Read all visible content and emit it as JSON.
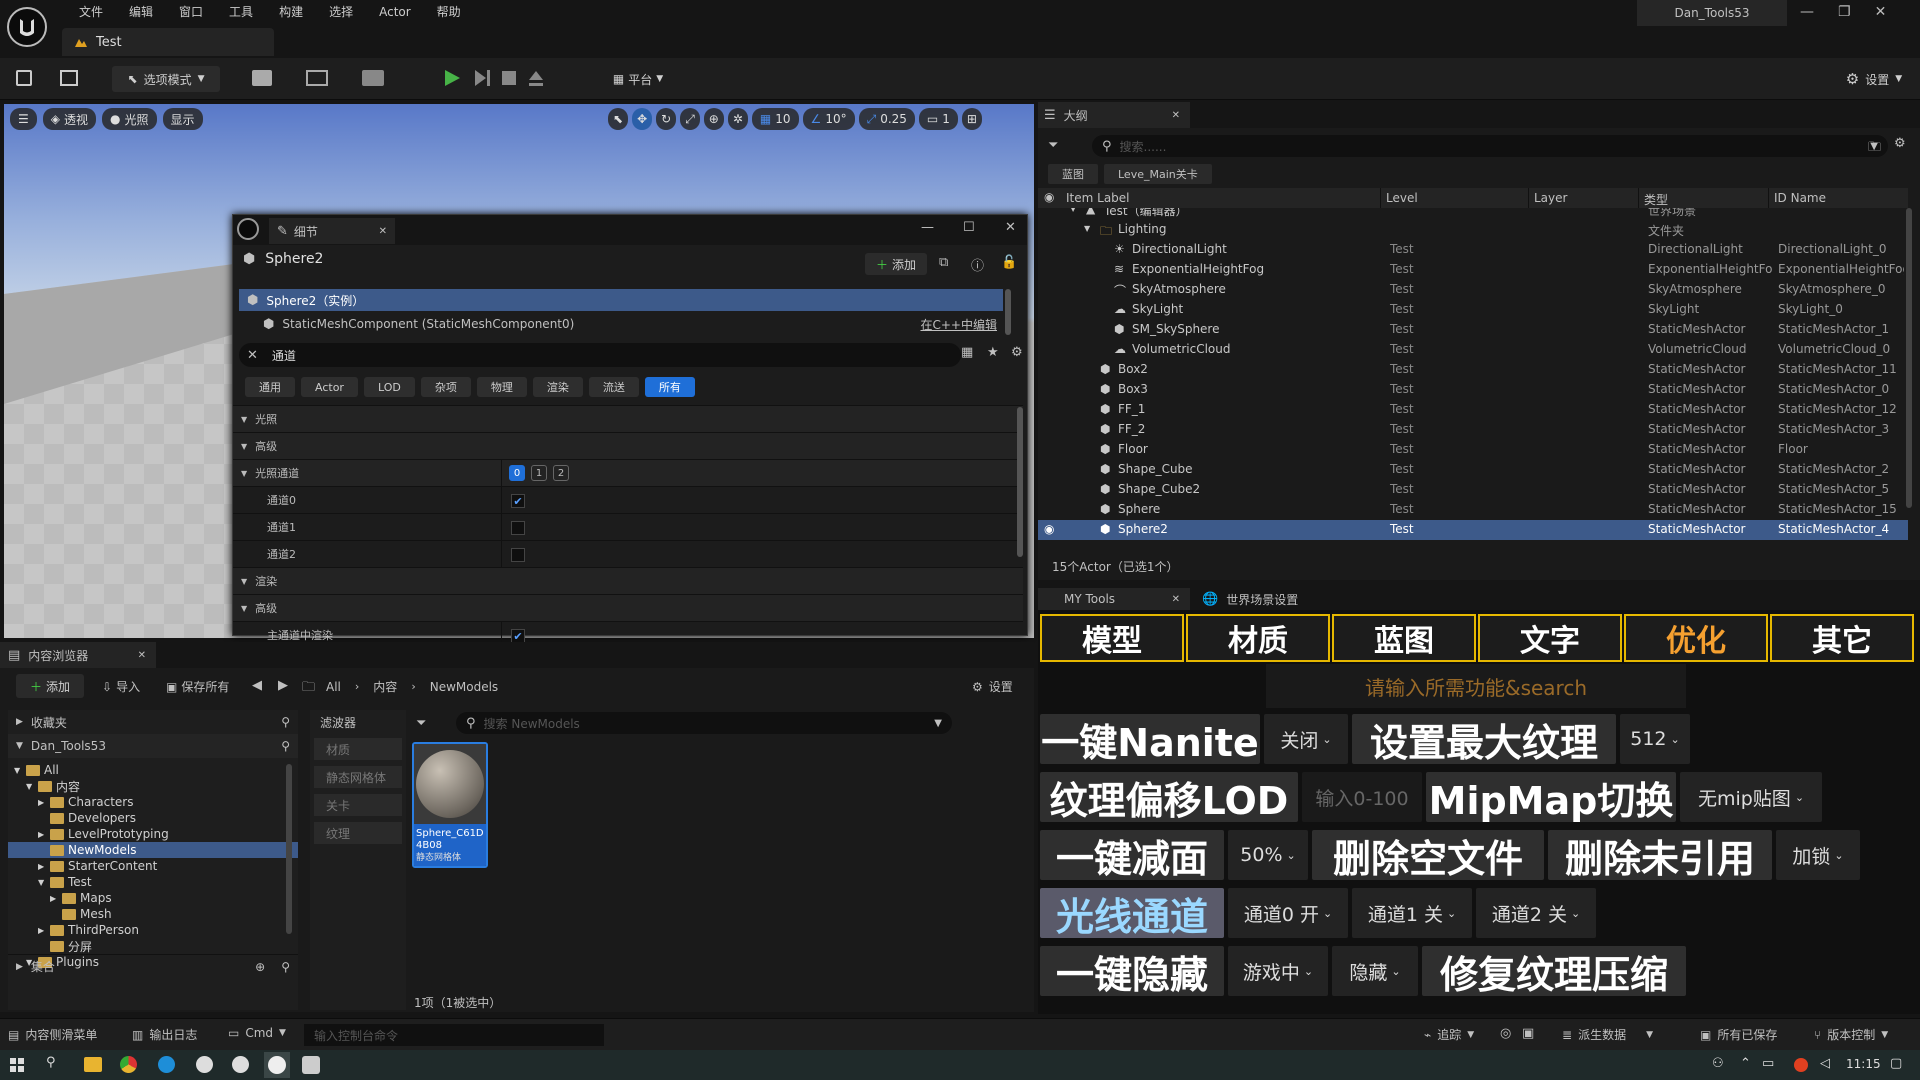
{
  "menu": [
    "文件",
    "编辑",
    "窗口",
    "工具",
    "构建",
    "选择",
    "Actor",
    "帮助"
  ],
  "project_name": "Dan_Tools53",
  "level_tab": "Test",
  "toolbar": {
    "mode": "选项模式",
    "platform": "平台",
    "settings": "设置"
  },
  "viewport": {
    "view": "透视",
    "lighting": "光照",
    "show": "显示",
    "grid": "10",
    "angle": "10°",
    "scale": "0.25",
    "camera": "1"
  },
  "details": {
    "title": "细节",
    "object": "Sphere2",
    "add": "添加",
    "instance": "Sphere2（实例）",
    "component": "StaticMeshComponent (StaticMeshComponent0)",
    "edit_cpp": "在C++中编辑",
    "search_value": "通道",
    "tabs": [
      "通用",
      "Actor",
      "LOD",
      "杂项",
      "物理",
      "渲染",
      "流送",
      "所有"
    ],
    "sections": [
      {
        "label": "光照",
        "level": 0,
        "type": "section"
      },
      {
        "label": "高级",
        "level": 0,
        "type": "section"
      },
      {
        "label": "光照通道",
        "level": 0,
        "type": "channels",
        "channels": [
          "0",
          "1",
          "2"
        ]
      },
      {
        "label": "通道0",
        "level": 1,
        "type": "checkbox",
        "checked": true
      },
      {
        "label": "通道1",
        "level": 1,
        "type": "checkbox",
        "checked": false
      },
      {
        "label": "通道2",
        "level": 1,
        "type": "checkbox",
        "checked": false
      },
      {
        "label": "渲染",
        "level": 0,
        "type": "section"
      },
      {
        "label": "高级",
        "level": 0,
        "type": "section"
      },
      {
        "label": "主通道中渲染",
        "level": 1,
        "type": "checkbox",
        "checked": true
      }
    ]
  },
  "outliner": {
    "title": "大纲",
    "search_placeholder": "搜索......",
    "filters": [
      "蓝图",
      "Leve_Main关卡"
    ],
    "columns": [
      "Item Label",
      "Level",
      "Layer",
      "类型",
      "ID Name"
    ],
    "rows": [
      {
        "label": "Test（编辑器）",
        "level": "",
        "type": "世界场景",
        "id": "",
        "indent": 0,
        "icon": "level"
      },
      {
        "label": "Lighting",
        "level": "",
        "type": "文件夹",
        "id": "",
        "indent": 1,
        "icon": "folder"
      },
      {
        "label": "DirectionalLight",
        "level": "Test",
        "type": "DirectionalLight",
        "id": "DirectionalLight_0",
        "indent": 2,
        "icon": "light"
      },
      {
        "label": "ExponentialHeightFog",
        "level": "Test",
        "type": "ExponentialHeightFog",
        "id": "ExponentialHeightFog",
        "indent": 2,
        "icon": "fog"
      },
      {
        "label": "SkyAtmosphere",
        "level": "Test",
        "type": "SkyAtmosphere",
        "id": "SkyAtmosphere_0",
        "indent": 2,
        "icon": "sky"
      },
      {
        "label": "SkyLight",
        "level": "Test",
        "type": "SkyLight",
        "id": "SkyLight_0",
        "indent": 2,
        "icon": "cloud"
      },
      {
        "label": "SM_SkySphere",
        "level": "Test",
        "type": "StaticMeshActor",
        "id": "StaticMeshActor_1",
        "indent": 2,
        "icon": "mesh"
      },
      {
        "label": "VolumetricCloud",
        "level": "Test",
        "type": "VolumetricCloud",
        "id": "VolumetricCloud_0",
        "indent": 2,
        "icon": "cloud"
      },
      {
        "label": "Box2",
        "level": "Test",
        "type": "StaticMeshActor",
        "id": "StaticMeshActor_11",
        "indent": 1,
        "icon": "mesh"
      },
      {
        "label": "Box3",
        "level": "Test",
        "type": "StaticMeshActor",
        "id": "StaticMeshActor_0",
        "indent": 1,
        "icon": "mesh"
      },
      {
        "label": "FF_1",
        "level": "Test",
        "type": "StaticMeshActor",
        "id": "StaticMeshActor_12",
        "indent": 1,
        "icon": "mesh"
      },
      {
        "label": "FF_2",
        "level": "Test",
        "type": "StaticMeshActor",
        "id": "StaticMeshActor_3",
        "indent": 1,
        "icon": "mesh"
      },
      {
        "label": "Floor",
        "level": "Test",
        "type": "StaticMeshActor",
        "id": "Floor",
        "indent": 1,
        "icon": "mesh"
      },
      {
        "label": "Shape_Cube",
        "level": "Test",
        "type": "StaticMeshActor",
        "id": "StaticMeshActor_2",
        "indent": 1,
        "icon": "mesh"
      },
      {
        "label": "Shape_Cube2",
        "level": "Test",
        "type": "StaticMeshActor",
        "id": "StaticMeshActor_5",
        "indent": 1,
        "icon": "mesh"
      },
      {
        "label": "Sphere",
        "level": "Test",
        "type": "StaticMeshActor",
        "id": "StaticMeshActor_15",
        "indent": 1,
        "icon": "mesh"
      },
      {
        "label": "Sphere2",
        "level": "Test",
        "type": "StaticMeshActor",
        "id": "StaticMeshActor_4",
        "indent": 1,
        "icon": "mesh",
        "selected": true
      }
    ],
    "footer": "15个Actor（已选1个）"
  },
  "mytools": {
    "tab": "MY Tools",
    "tab2": "世界场景设置",
    "categories": [
      "模型",
      "材质",
      "蓝图",
      "文字",
      "优化",
      "其它"
    ],
    "active_category": 4,
    "search_placeholder": "请输入所需功能&search",
    "rows": [
      [
        {
          "t": "big",
          "label": "一键Nanite",
          "w": 220
        },
        {
          "t": "sel",
          "label": "关闭",
          "w": 84
        },
        {
          "t": "big",
          "label": "设置最大纹理",
          "w": 264
        },
        {
          "t": "sel",
          "label": "512",
          "w": 70
        }
      ],
      [
        {
          "t": "big",
          "label": "纹理偏移LOD",
          "w": 258
        },
        {
          "t": "input",
          "label": "输入0-100",
          "w": 120
        },
        {
          "t": "big",
          "label": "MipMap切换",
          "w": 250
        },
        {
          "t": "sel",
          "label": "无mip贴图",
          "w": 142
        }
      ],
      [
        {
          "t": "big",
          "label": "一键减面",
          "w": 184
        },
        {
          "t": "sel",
          "label": "50%",
          "w": 80
        },
        {
          "t": "big",
          "label": "删除空文件",
          "w": 232
        },
        {
          "t": "big",
          "label": "删除未引用",
          "w": 224
        },
        {
          "t": "sel",
          "label": "加锁",
          "w": 84
        }
      ],
      [
        {
          "t": "big",
          "label": "光线通道",
          "w": 184,
          "accent": true
        },
        {
          "t": "sel",
          "label": "通道0 开",
          "w": 120
        },
        {
          "t": "sel",
          "label": "通道1 关",
          "w": 120
        },
        {
          "t": "sel",
          "label": "通道2 关",
          "w": 120
        }
      ],
      [
        {
          "t": "big",
          "label": "一键隐藏",
          "w": 184
        },
        {
          "t": "sel",
          "label": "游戏中",
          "w": 100
        },
        {
          "t": "sel",
          "label": "隐藏",
          "w": 86
        },
        {
          "t": "big",
          "label": "修复纹理压缩",
          "w": 264
        }
      ]
    ]
  },
  "content_browser": {
    "title": "内容浏览器",
    "add": "添加",
    "import": "导入",
    "save_all": "保存所有",
    "path": [
      "All",
      "内容",
      "NewModels"
    ],
    "settings": "设置",
    "favorites": "收藏夹",
    "project": "Dan_Tools53",
    "tree": [
      {
        "label": "All",
        "indent": 0,
        "open": true
      },
      {
        "label": "内容",
        "indent": 1,
        "open": true
      },
      {
        "label": "Characters",
        "indent": 2,
        "arrow": true
      },
      {
        "label": "Developers",
        "indent": 2
      },
      {
        "label": "LevelPrototyping",
        "indent": 2,
        "arrow": true
      },
      {
        "label": "NewModels",
        "indent": 2,
        "selected": true
      },
      {
        "label": "StarterContent",
        "indent": 2,
        "arrow": true
      },
      {
        "label": "Test",
        "indent": 2,
        "open": true
      },
      {
        "label": "Maps",
        "indent": 3,
        "arrow": true
      },
      {
        "label": "Mesh",
        "indent": 3
      },
      {
        "label": "ThirdPerson",
        "indent": 2,
        "arrow": true
      },
      {
        "label": "分屏",
        "indent": 2
      },
      {
        "label": "Plugins",
        "indent": 1,
        "open": true
      }
    ],
    "collections": "集合",
    "filters_title": "滤波器",
    "filters": [
      "材质",
      "静态网格体",
      "关卡",
      "纹理"
    ],
    "search_placeholder": "搜索 NewModels",
    "asset_name": "Sphere_C61D4B08",
    "asset_type": "静态网格体",
    "item_count": "1项（1被选中）"
  },
  "statusbar": {
    "drawer": "内容侧滑菜单",
    "log": "输出日志",
    "cmd": "Cmd",
    "console_placeholder": "输入控制台命令",
    "trace": "追踪",
    "derived": "派生数据",
    "saved": "所有已保存",
    "vcs": "版本控制"
  },
  "taskbar": {
    "time": "11:15"
  }
}
